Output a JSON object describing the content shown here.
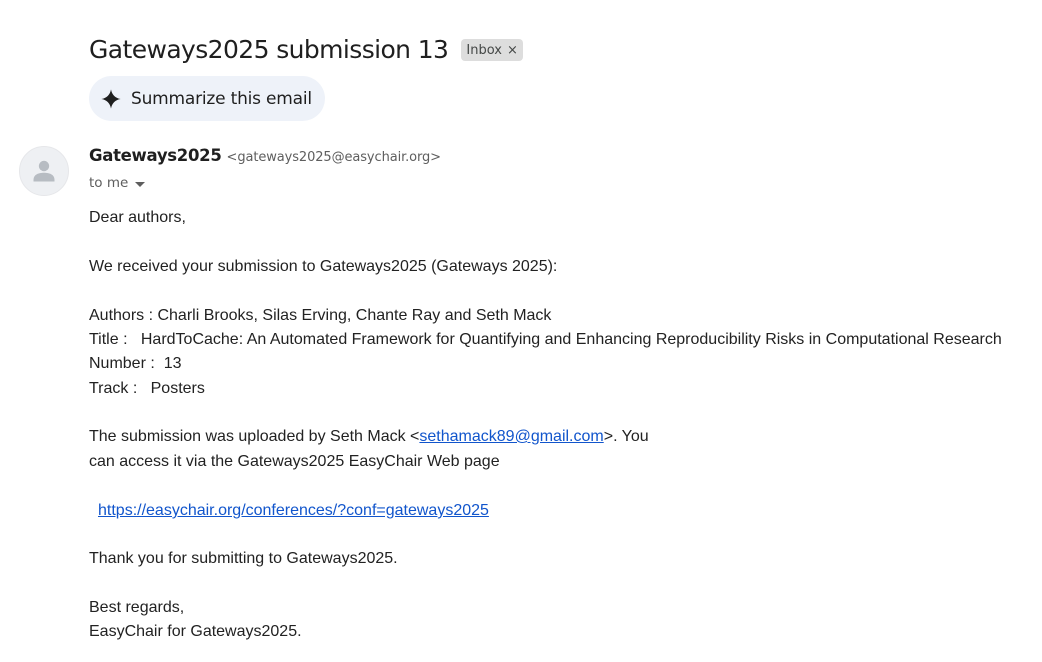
{
  "email": {
    "subject": "Gateways2025 submission 13",
    "label": "Inbox",
    "label_close_glyph": "×",
    "summarize_label": "Summarize this email",
    "summarize_icon": "sparkle-icon",
    "avatar_icon": "person-icon",
    "sender_name": "Gateways2025",
    "sender_email": "<gateways2025@easychair.org>",
    "to_label": "to me",
    "body": {
      "greeting": "Dear authors,",
      "received": "We received your submission to Gateways2025 (Gateways 2025):",
      "authors": "Authors : Charli Brooks, Silas Erving, Chante Ray and Seth Mack",
      "title": "Title :   HardToCache: An Automated Framework for Quantifying and Enhancing Reproducibility Risks in Computational Research",
      "number": "Number :  13",
      "track": "Track :   Posters",
      "uploaded_prefix": "The submission was uploaded by Seth Mack <",
      "uploader_email": "sethamack89@gmail.com",
      "uploaded_suffix": ">. You",
      "access_line": "can access it via the Gateways2025 EasyChair Web page",
      "web_url": "https://easychair.org/conferences/?conf=gateways2025",
      "thanks": "Thank you for submitting to Gateways2025.",
      "regards": "Best regards,",
      "signature": "EasyChair for Gateways2025."
    }
  },
  "colors": {
    "link": "#1155cc",
    "summarize_bg": "#eef2f9",
    "label_bg": "#dddddd",
    "secondary_text": "#5e5e5e"
  }
}
